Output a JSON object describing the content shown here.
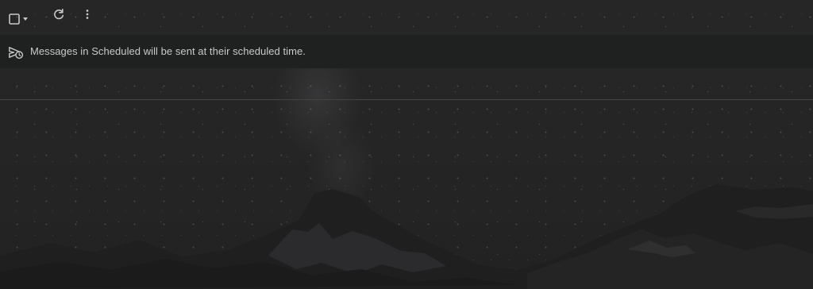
{
  "toolbar": {
    "select_all": {
      "icon": "checkbox-outline-icon",
      "menu_icon": "caret-down-icon"
    },
    "refresh": {
      "icon": "refresh-icon"
    },
    "more": {
      "icon": "more-vert-icon"
    }
  },
  "banner": {
    "icon": "scheduled-send-icon",
    "text": "Messages in Scheduled will be sent at their scheduled time."
  },
  "colors": {
    "icon": "#c8c8c8",
    "banner_background": "#1f2020",
    "banner_text": "#c9c9c9",
    "divider": "#434343"
  }
}
